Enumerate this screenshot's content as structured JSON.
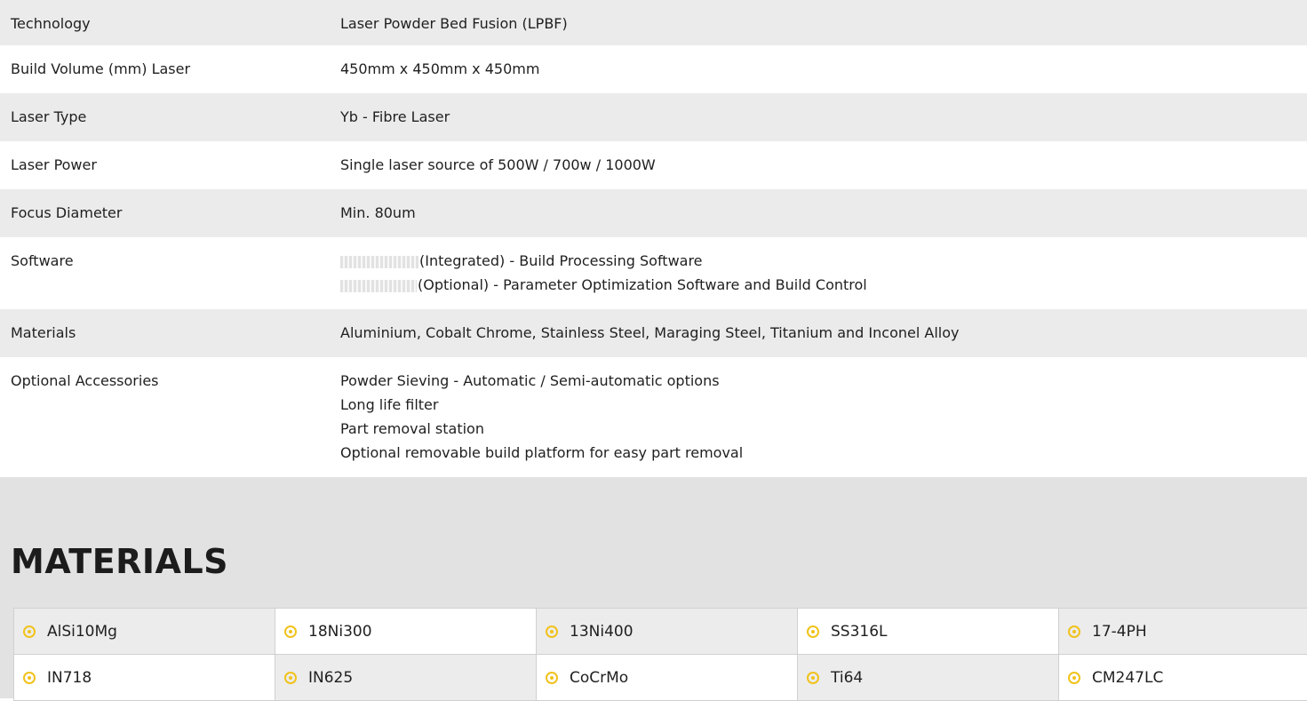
{
  "specs": [
    {
      "label": "Technology",
      "value": [
        "Laser Powder Bed Fusion (LPBF)"
      ]
    },
    {
      "label": "Build Volume (mm) Laser",
      "value": [
        "450mm x 450mm x 450mm"
      ]
    },
    {
      "label": "Laser Type",
      "value": [
        "Yb - Fibre Laser"
      ]
    },
    {
      "label": "Laser Power",
      "value": [
        "Single laser source of 500W / 700w / 1000W"
      ]
    },
    {
      "label": "Focus Diameter",
      "value": [
        "Min. 80um"
      ]
    },
    {
      "label": "Software",
      "value": [
        "(Integrated) - Build Processing Software",
        "(Optional) - Parameter Optimization Software and Build Control"
      ]
    },
    {
      "label": "Materials",
      "value": [
        "Aluminium, Cobalt Chrome, Stainless Steel, Maraging Steel, Titanium and Inconel Alloy"
      ]
    },
    {
      "label": "Optional Accessories",
      "value": [
        "Powder Sieving - Automatic / Semi-automatic options",
        "Long life filter",
        "Part removal station",
        "Optional removable build platform for easy part removal"
      ]
    }
  ],
  "materials": {
    "title": "MATERIALS",
    "items": [
      "AlSi10Mg",
      "18Ni300",
      "13Ni400",
      "SS316L",
      "17-4PH",
      "IN718",
      "IN625",
      "CoCrMo",
      "Ti64",
      "CM247LC"
    ]
  },
  "colors": {
    "accent": "#f1c21b",
    "row_alt": "#ebebeb",
    "section_bg": "#e2e2e2"
  }
}
